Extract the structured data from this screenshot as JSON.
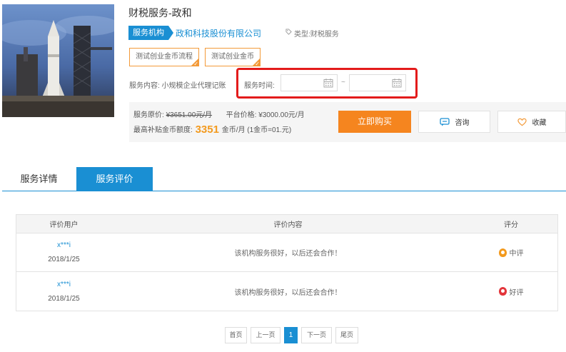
{
  "service": {
    "title": "财税服务-政和",
    "org_tag": "服务机构",
    "org_name": "政和科技股份有限公司",
    "type_label": "类型:财税服务",
    "coin_buttons": [
      "测试创业金币流程",
      "测试创业金币"
    ],
    "content_label": "服务内容: 小规模企业代理记账",
    "time_label": "服务时间:",
    "date_separator": "~"
  },
  "pricing": {
    "original_label": "服务原价:",
    "original_price": "¥3651.00元/月",
    "platform_label": "平台价格:",
    "platform_price": "¥3000.00元/月",
    "subsidy_label": "最高补贴金币额度:",
    "subsidy_amount": "3351",
    "subsidy_suffix": "金币/月 (1金币=01.元)"
  },
  "actions": {
    "buy": "立即购买",
    "consult": "咨询",
    "favorite": "收藏"
  },
  "tabs": [
    {
      "label": "服务详情",
      "active": false
    },
    {
      "label": "服务评价",
      "active": true
    }
  ],
  "reviews": {
    "headers": [
      "评价用户",
      "评价内容",
      "评分"
    ],
    "rows": [
      {
        "user": "x***i",
        "date": "2018/1/25",
        "content": "该机构服务很好，以后还会合作！",
        "score": "中评"
      },
      {
        "user": "x***i",
        "date": "2018/1/25",
        "content": "该机构服务很好，以后还会合作！",
        "score": "好评"
      }
    ]
  },
  "pagination": {
    "first": "首页",
    "prev": "上一页",
    "current": "1",
    "next": "下一页",
    "last": "尾页"
  },
  "colors": {
    "accent_blue": "#1a8fd3",
    "buy_orange": "#f5851f",
    "highlight_red": "#e31b1b",
    "coin_orange": "#f39a39"
  },
  "icons": {
    "tag": "tag-icon",
    "calendar": "calendar-icon",
    "consult": "chat-bubble-icon",
    "favorite": "heart-icon",
    "score_mid": "medal-icon",
    "score_good": "medal-icon"
  }
}
